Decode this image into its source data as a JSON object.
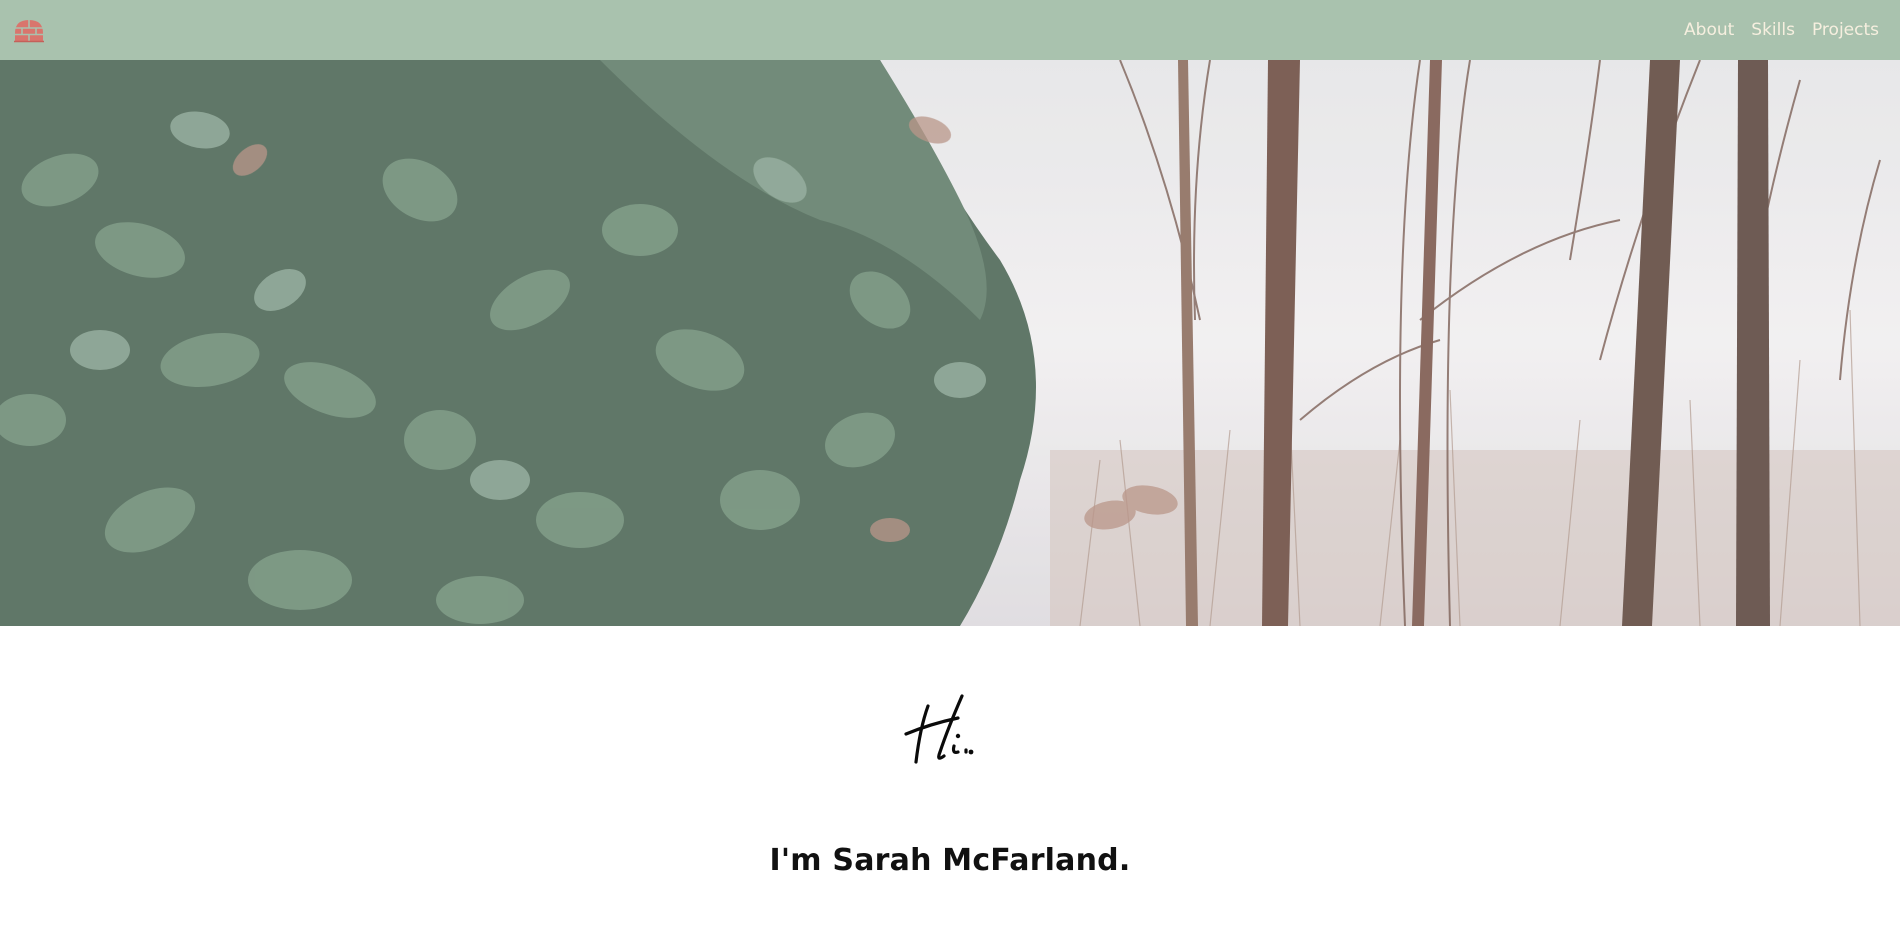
{
  "navbar": {
    "logo_icon": "red-brick-dome-icon",
    "bg_color": "#a9c2ae",
    "link_color": "#f6efdf",
    "links": [
      {
        "label": "About"
      },
      {
        "label": "Skills"
      },
      {
        "label": "Projects"
      }
    ]
  },
  "hero": {
    "subject": "eucalyptus-foliage-and-bare-trees-photo"
  },
  "intro": {
    "greeting": "Hi.",
    "headline": "I'm Sarah McFarland."
  }
}
